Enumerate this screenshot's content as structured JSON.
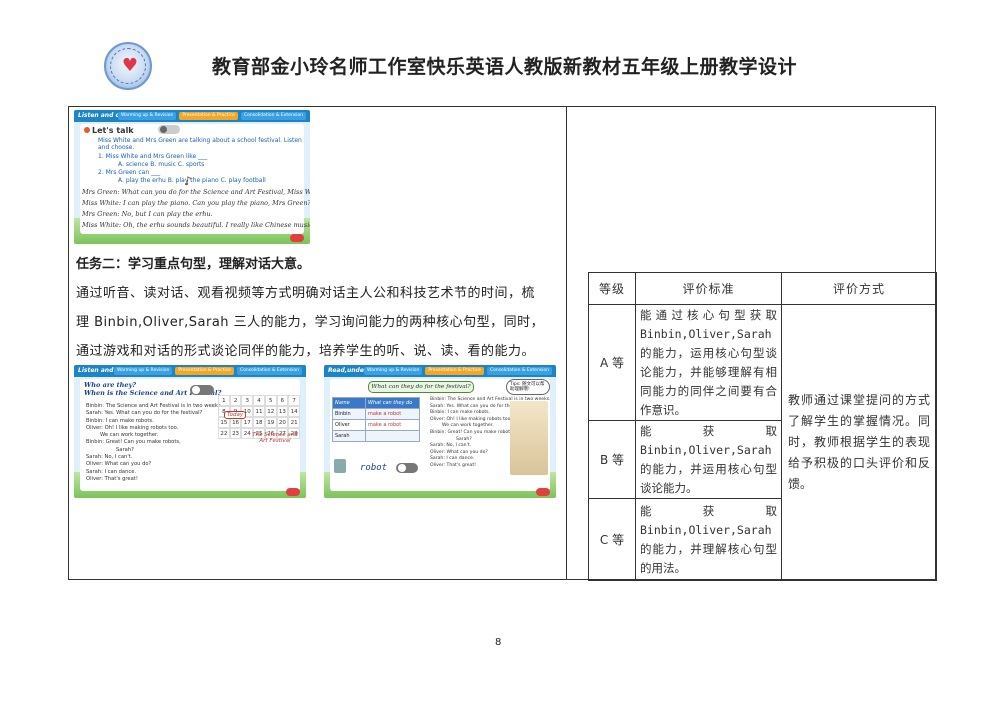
{
  "header": {
    "title": "教育部金小玲名师工作室快乐英语人教版新教材五年级上册教学设计"
  },
  "slide1": {
    "tag": "Listen and choose",
    "tabs": [
      "Warming up & Revision",
      "Presentation & Practice",
      "Consolidation & Extension"
    ],
    "heading": "Let's talk",
    "lines": [
      "Miss White and Mrs Green are talking about a school festival. Listen",
      "and choose.",
      "1. Miss White and Mrs Green like ___",
      "A. science        B. music        C. sports",
      "2. Mrs Green can ___",
      "A. play the erhu   B. play the piano   C. play football",
      "Mrs Green: What can you do for the Science and Art Festival, Miss White?",
      "Miss White: I can play the piano. Can you play the piano, Mrs Green?",
      "Mrs Green: No, but I can play the erhu.",
      "Miss White: Oh, the erhu sounds beautiful. I really like Chinese music."
    ]
  },
  "task": {
    "title": "任务二：学习重点句型，理解对话大意。",
    "paragraph_lines": [
      "通过听音、读对话、观看视频等方式明确对话主人公和科技艺术节的时间，梳",
      "理 Binbin,Oliver,Sarah 三人的能力，学习询问能力的两种核心句型，同时，",
      "通过游戏和对话的形式谈论同伴的能力，培养学生的听、说、读、看的能力。"
    ]
  },
  "slide2": {
    "tag": "Listen and circle",
    "tabs": [
      "Warming up & Revision",
      "Presentation & Practice",
      "Consolidation & Extension"
    ],
    "q1": "Who are they?",
    "q2": "When is the Science and Art Festival?",
    "lines": [
      "Binbin: The Science and Art Festival is in two weeks.",
      "Sarah: Yes. What can you do for the festival?",
      "Binbin: I can make robots.",
      "Oliver: Oh! I like making robots too.",
      "We can work together.",
      "Binbin: Great! Can you make robots,",
      "Sarah?",
      "Sarah: No, I can't.",
      "Oliver: What can you do?",
      "Sarah: I can dance.",
      "Oliver: That's great!"
    ],
    "calendar": [
      "1",
      "2",
      "3",
      "4",
      "5",
      "6",
      "7",
      "8",
      "9",
      "10",
      "11",
      "12",
      "13",
      "14",
      "15",
      "16",
      "17",
      "18",
      "19",
      "20",
      "21",
      "22",
      "23",
      "24",
      "25",
      "26",
      "27",
      "28"
    ],
    "today": "Today",
    "festival_note": "The Science and Art Festival"
  },
  "slide3": {
    "tag": "Read,underline and fill",
    "tabs": [
      "Warming up & Revision",
      "Presentation & Practice",
      "Consolidation & Extension"
    ],
    "question": "What can they do for the festival?",
    "bubble": "Tips: 随文可以帮助理解哦!",
    "table_headers": [
      "Name",
      "What can they do"
    ],
    "table_rows": [
      [
        "Binbin",
        "make a robot"
      ],
      [
        "Oliver",
        "make a robot"
      ],
      [
        "Sarah",
        ""
      ]
    ],
    "word": "robot",
    "lines": [
      "Binbin: The Science and Art Festival is in two weeks.",
      "Sarah: Yes. What can you do for the festival?",
      "Binbin: I can make robots.",
      "Oliver: Oh! I like making robots too.",
      "We can work together.",
      "Binbin: Great! Can you make robots,",
      "Sarah?",
      "Sarah: No, I can't.",
      "Oliver: What can you do?",
      "Sarah: I can dance.",
      "Oliver: That's great!"
    ]
  },
  "evaluation": {
    "headers": [
      "等级",
      "评价标准",
      "评价方式"
    ],
    "rows": [
      {
        "grade": "A 等",
        "criteria": "能通过核心句型获取Binbin,Oliver,Sarah的能力，运用核心句型谈论能力，并能够理解有相同能力的同伴之间要有合作意识。"
      },
      {
        "grade": "B 等",
        "criteria": "能获取Binbin,Oliver,Sarah的能力，并运用核心句型谈论能力。"
      },
      {
        "grade": "C 等",
        "criteria": "能获取Binbin,Oliver,Sarah的能力，并理解核心句型的用法。"
      }
    ],
    "method": "教师通过课堂提问的方式了解学生的掌握情况。同时，教师根据学生的表现给予积极的口头评价和反馈。"
  },
  "page_number": "8"
}
